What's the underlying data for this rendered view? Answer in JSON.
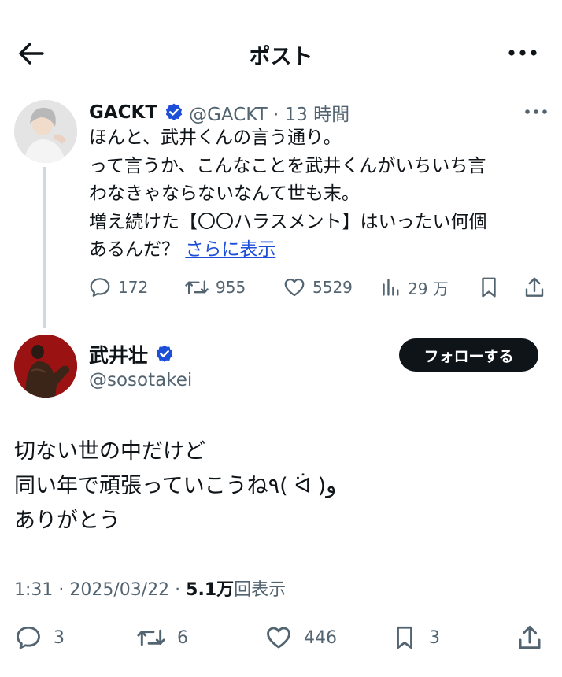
{
  "header": {
    "title": "ポスト",
    "back_icon": "arrow-left-icon",
    "more_icon": "more-horizontal-icon"
  },
  "quoted_tweet": {
    "display_name": "GACKT",
    "verified_icon": "verified-badge-icon",
    "handle_time": "@GACKT · 13 時間",
    "text_lines": [
      "ほんと、武井くんの言う通り。",
      "って言うか、こんなことを武井くんがいちいち言",
      "わなきゃならないなんて世も末。",
      "増え続けた【〇〇ハラスメント】はいったい何個",
      "あるんだ？"
    ],
    "show_more": "さらに表示",
    "stats": {
      "replies": "172",
      "reposts": "955",
      "likes": "5529",
      "views": "29 万"
    }
  },
  "main_tweet": {
    "display_name": "武井壮",
    "verified_icon": "verified-badge-icon",
    "handle": "@sosotakei",
    "follow_label": "フォローする",
    "text_lines": [
      "切ない世の中だけど",
      "同い年で頑張っていこうね٩( ᐛ )و",
      "ありがとう"
    ],
    "timestamp": "1:31 · 2025/03/22 · ",
    "views_count": "5.1万",
    "views_label": "回表示",
    "actions": {
      "replies": "3",
      "reposts": "6",
      "likes": "446",
      "bookmarks": "3"
    }
  },
  "colors": {
    "text": "#0f1419",
    "secondary": "#536471",
    "link": "#1d4ed8",
    "verified": "#1d4ed8",
    "follow_bg": "#0f1419"
  }
}
